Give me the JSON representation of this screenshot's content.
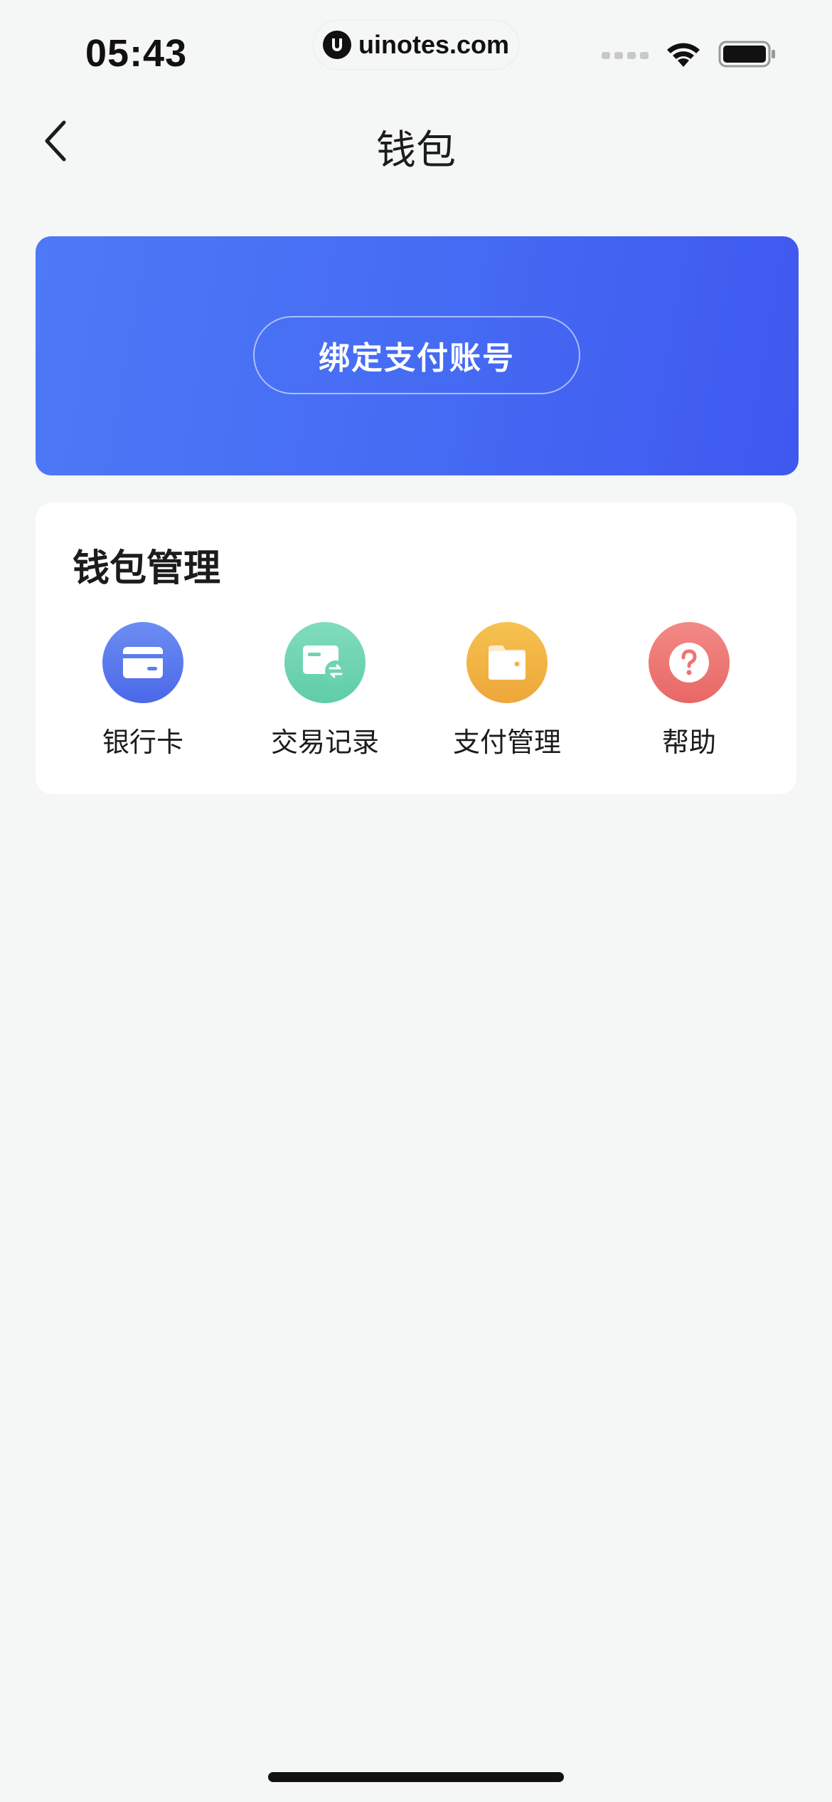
{
  "status_bar": {
    "time": "05:43",
    "watermark": "uinotes.com",
    "icons": [
      "signal-icon",
      "wifi-icon",
      "battery-icon"
    ]
  },
  "nav": {
    "back_icon": "chevron-left-icon",
    "title": "钱包"
  },
  "banner": {
    "bind_button_label": "绑定支付账号",
    "gradient": [
      "#4d79f6",
      "#3f58f0"
    ]
  },
  "wallet_manage": {
    "title": "钱包管理",
    "items": [
      {
        "label": "银行卡",
        "icon": "bank-card-icon",
        "color": "#5276ec"
      },
      {
        "label": "交易记录",
        "icon": "transaction-record-icon",
        "color": "#6fd3b2"
      },
      {
        "label": "支付管理",
        "icon": "wallet-folder-icon",
        "color": "#f2b347"
      },
      {
        "label": "帮助",
        "icon": "help-icon",
        "color": "#ee7474"
      }
    ]
  },
  "colors": {
    "background": "#f5f7f6",
    "accent": "#4565f2"
  }
}
